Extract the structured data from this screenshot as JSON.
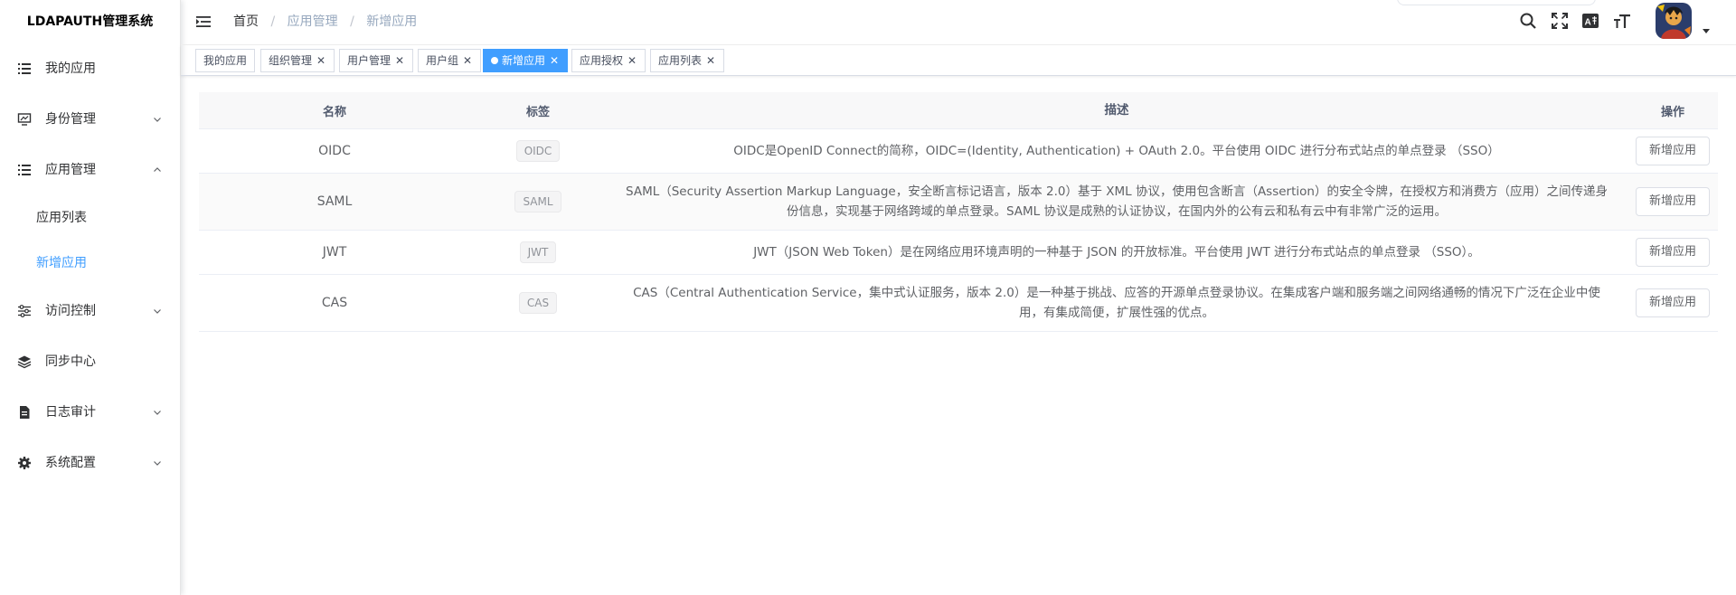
{
  "app": {
    "title": "LDAPAUTH管理系统"
  },
  "sidebar": {
    "items": [
      {
        "label": "我的应用",
        "icon": "list-icon"
      },
      {
        "label": "身份管理",
        "icon": "monitor-icon",
        "expandable": true
      },
      {
        "label": "应用管理",
        "icon": "list-icon",
        "expandable": true,
        "expanded": true,
        "children": [
          {
            "label": "应用列表"
          },
          {
            "label": "新增应用",
            "active": true
          }
        ]
      },
      {
        "label": "访问控制",
        "icon": "sliders-icon",
        "expandable": true
      },
      {
        "label": "同步中心",
        "icon": "layers-icon"
      },
      {
        "label": "日志审计",
        "icon": "document-icon",
        "expandable": true
      },
      {
        "label": "系统配置",
        "icon": "gear-icon",
        "expandable": true
      }
    ]
  },
  "breadcrumb": {
    "home": "首页",
    "section": "应用管理",
    "current": "新增应用"
  },
  "tags": [
    {
      "label": "我的应用",
      "closable": false
    },
    {
      "label": "组织管理",
      "closable": true
    },
    {
      "label": "用户管理",
      "closable": true
    },
    {
      "label": "用户组",
      "closable": true
    },
    {
      "label": "新增应用",
      "closable": true,
      "active": true
    },
    {
      "label": "应用授权",
      "closable": true
    },
    {
      "label": "应用列表",
      "closable": true
    }
  ],
  "table": {
    "headers": {
      "name": "名称",
      "tag": "标签",
      "desc": "描述",
      "action": "操作"
    },
    "rows": [
      {
        "name": "OIDC",
        "tag": "OIDC",
        "desc": "OIDC是OpenID Connect的简称，OIDC=(Identity, Authentication) + OAuth 2.0。平台使用 OIDC 进行分布式站点的单点登录 （SSO）",
        "action": "新增应用"
      },
      {
        "name": "SAML",
        "tag": "SAML",
        "desc": "SAML（Security Assertion Markup Language，安全断言标记语言，版本 2.0）基于 XML 协议，使用包含断言（Assertion）的安全令牌，在授权方和消费方（应用）之间传递身份信息，实现基于网络跨域的单点登录。SAML 协议是成熟的认证协议，在国内外的公有云和私有云中有非常广泛的运用。",
        "action": "新增应用"
      },
      {
        "name": "JWT",
        "tag": "JWT",
        "desc": "JWT（JSON Web Token）是在网络应用环境声明的一种基于 JSON 的开放标准。平台使用 JWT 进行分布式站点的单点登录 （SSO）。",
        "action": "新增应用"
      },
      {
        "name": "CAS",
        "tag": "CAS",
        "desc": "CAS（Central Authentication Service，集中式认证服务，版本 2.0）是一种基于挑战、应答的开源单点登录协议。在集成客户端和服务端之间网络通畅的情况下广泛在企业中使用，有集成简便，扩展性强的优点。",
        "action": "新增应用"
      }
    ]
  },
  "colors": {
    "primary": "#409eff",
    "text": "#303133",
    "muted": "#97a8be"
  }
}
